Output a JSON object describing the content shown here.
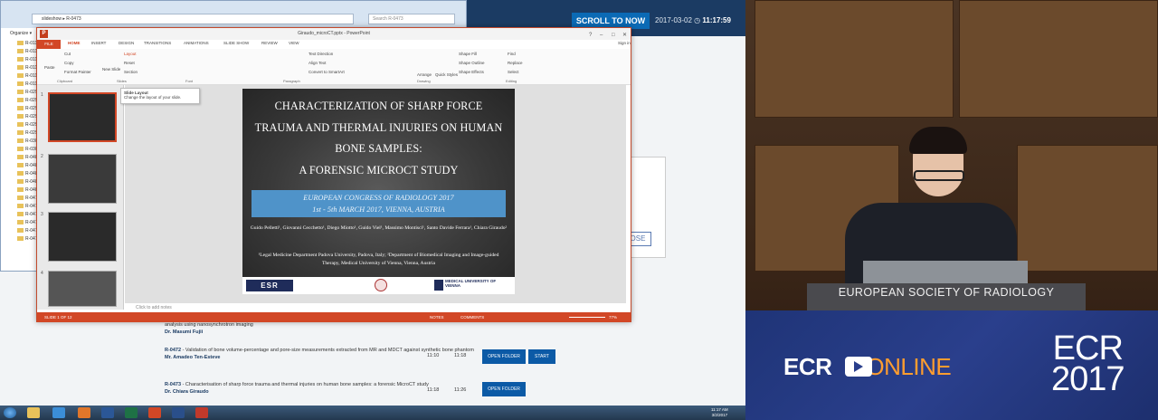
{
  "webpage": {
    "scroll_button": "SCROLL TO NOW",
    "date": "2017-03-02",
    "time": "11:17:59",
    "close_label": "OSE",
    "rows": [
      {
        "code": "",
        "title": "analysis using nanosynchrotron imaging",
        "author": "Dr. Masumi Fujii",
        "start": "",
        "end": "",
        "buttons": []
      },
      {
        "code": "R-0472",
        "title": " - Validation of bone volume-percentage and pore-size measurements extracted from MR and MDCT against synthetic bone phantom",
        "author": "Mr. Amadeo Ten-Esteve",
        "start": "11:10",
        "end": "11:18",
        "buttons": [
          "OPEN FOLDER",
          "START"
        ]
      },
      {
        "code": "R-0473",
        "title": " - Characterisation of sharp force trauma and thermal injuries on human bone samples: a forensic MicroCT study",
        "author": "Dr. Chiara Giraudo",
        "start": "11:18",
        "end": "11:26",
        "buttons": [
          "OPEN FOLDER"
        ]
      }
    ]
  },
  "explorer": {
    "path": "slideshow ▸ R-0473",
    "search_placeholder": "Search R-0473",
    "organize": "Organize ▾",
    "folders": [
      "R-0114",
      "R-0115",
      "R-0116",
      "R-0117",
      "R-0118",
      "R-0119",
      "R-0294",
      "R-0295",
      "R-0296",
      "R-0297",
      "R-0298",
      "R-0299",
      "R-0300",
      "R-0301",
      "R-0485",
      "R-0486",
      "R-0487",
      "R-0488",
      "R-0489",
      "R-0470",
      "R-0471",
      "R-0472",
      "R-0473",
      "R-0474",
      "R-0475"
    ]
  },
  "ppt": {
    "title": "Giraudo_microCT.pptx - PowerPoint",
    "tabs": [
      "FILE",
      "HOME",
      "INSERT",
      "DESIGN",
      "TRANSITIONS",
      "ANIMATIONS",
      "SLIDE SHOW",
      "REVIEW",
      "VIEW"
    ],
    "sign_in": "Sign in",
    "ribbon": {
      "paste": "Paste",
      "cut": "Cut",
      "copy": "Copy",
      "format_painter": "Format Painter",
      "new_slide": "New Slide",
      "layout": "Layout",
      "reset": "Reset",
      "section": "Section",
      "text_direction": "Text Direction",
      "align_text": "Align Text",
      "convert_smartart": "Convert to SmartArt",
      "arrange": "Arrange",
      "quick_styles": "Quick Styles",
      "shape_fill": "Shape Fill",
      "shape_outline": "Shape Outline",
      "shape_effects": "Shape Effects",
      "find": "Find",
      "replace": "Replace",
      "select": "Select",
      "groups": [
        "Clipboard",
        "Slides",
        "Font",
        "Paragraph",
        "Drawing",
        "Editing"
      ]
    },
    "tooltip_title": "Slide Layout",
    "tooltip_text": "Change the layout of your slide.",
    "thumb_numbers": [
      "1",
      "2",
      "3",
      "4"
    ],
    "notes_placeholder": "Click to add notes",
    "status_left": "SLIDE 1 OF 12",
    "status_notes": "NOTES",
    "status_comments": "COMMENTS",
    "zoom": "77%"
  },
  "slide": {
    "title_lines": [
      "CHARACTERIZATION OF SHARP FORCE",
      "TRAUMA AND THERMAL INJURIES ON HUMAN",
      "BONE SAMPLES:",
      "A FORENSIC MICROCT STUDY"
    ],
    "congress_line1": "EUROPEAN CONGRESS OF RADIOLOGY 2017",
    "congress_line2": "1st - 5th MARCH 2017, VIENNA, AUSTRIA",
    "authors": "Guido Pelletti¹, Giovanni Cecchetto¹, Diego Miotto¹, Guido Viel¹, Massimo Montisci¹, Santo Davide Ferrara¹, Chiara Giraudo²",
    "affiliations": "¹Legal Medicine Department Padova University, Padova, Italy; ²Department of Biomedical Imaging and Image-guided Therapy, Medical University of Vienna, Vienna, Austria",
    "logo_esr": "ESR",
    "logo_vienna": "MEDICAL UNIVERSITY OF VIENNA"
  },
  "taskbar": {
    "time": "11:17 AM",
    "date": "3/2/2017"
  },
  "stage": {
    "podium_label": "EUROPEAN SOCIETY OF RADIOLOGY",
    "ecr_prefix": "ECR",
    "ecr_suffix": "ONLINE",
    "ecr_logo_top": "ECR",
    "ecr_logo_bottom": "2017"
  },
  "colors": {
    "ppt_accent": "#d24726",
    "banner_blue": "#2a3f8c",
    "online_orange": "#ff9d2f"
  }
}
